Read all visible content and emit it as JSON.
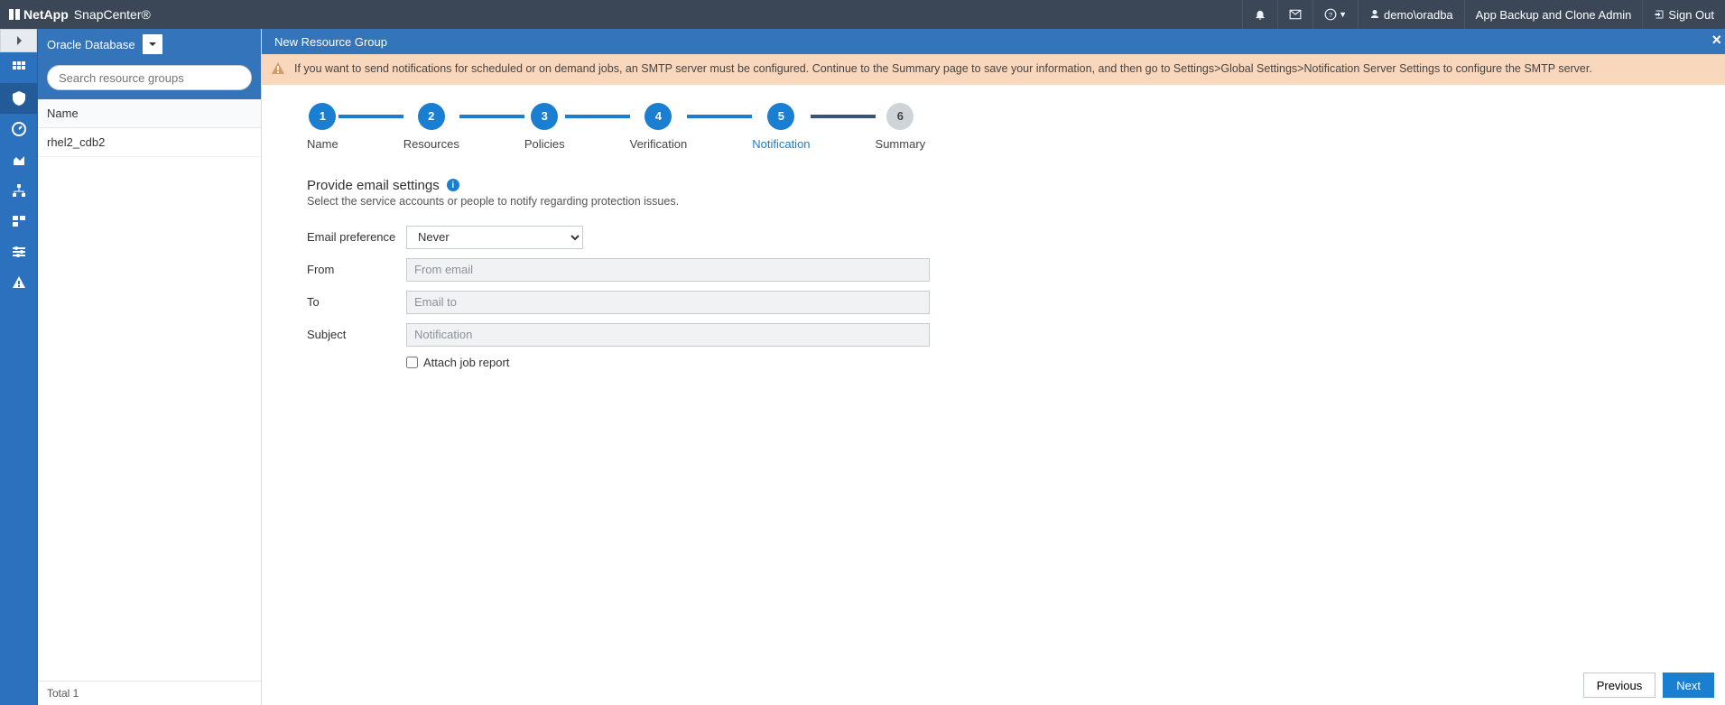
{
  "brand": {
    "company": "NetApp",
    "app": "SnapCenter®"
  },
  "topnav": {
    "user": "demo\\oradba",
    "role": "App Backup and Clone Admin",
    "signout": "Sign Out"
  },
  "sidepanel": {
    "selector": "Oracle Database",
    "search_placeholder": "Search resource groups",
    "header": "Name",
    "rows": [
      "rhel2_cdb2"
    ],
    "footer": "Total 1"
  },
  "crumb": "New Resource Group",
  "warning": "If you want to send notifications for scheduled or on demand jobs, an SMTP server must be configured. Continue to the Summary page to save your information, and then go to Settings>Global Settings>Notification Server Settings to configure the SMTP server.",
  "steps": [
    {
      "n": "1",
      "label": "Name"
    },
    {
      "n": "2",
      "label": "Resources"
    },
    {
      "n": "3",
      "label": "Policies"
    },
    {
      "n": "4",
      "label": "Verification"
    },
    {
      "n": "5",
      "label": "Notification"
    },
    {
      "n": "6",
      "label": "Summary"
    }
  ],
  "form": {
    "title": "Provide email settings",
    "subtitle": "Select the service accounts or people to notify regarding protection issues.",
    "pref_label": "Email preference",
    "pref_value": "Never",
    "from_label": "From",
    "from_ph": "From email",
    "to_label": "To",
    "to_ph": "Email to",
    "subj_label": "Subject",
    "subj_ph": "Notification",
    "attach": "Attach job report"
  },
  "buttons": {
    "prev": "Previous",
    "next": "Next"
  }
}
